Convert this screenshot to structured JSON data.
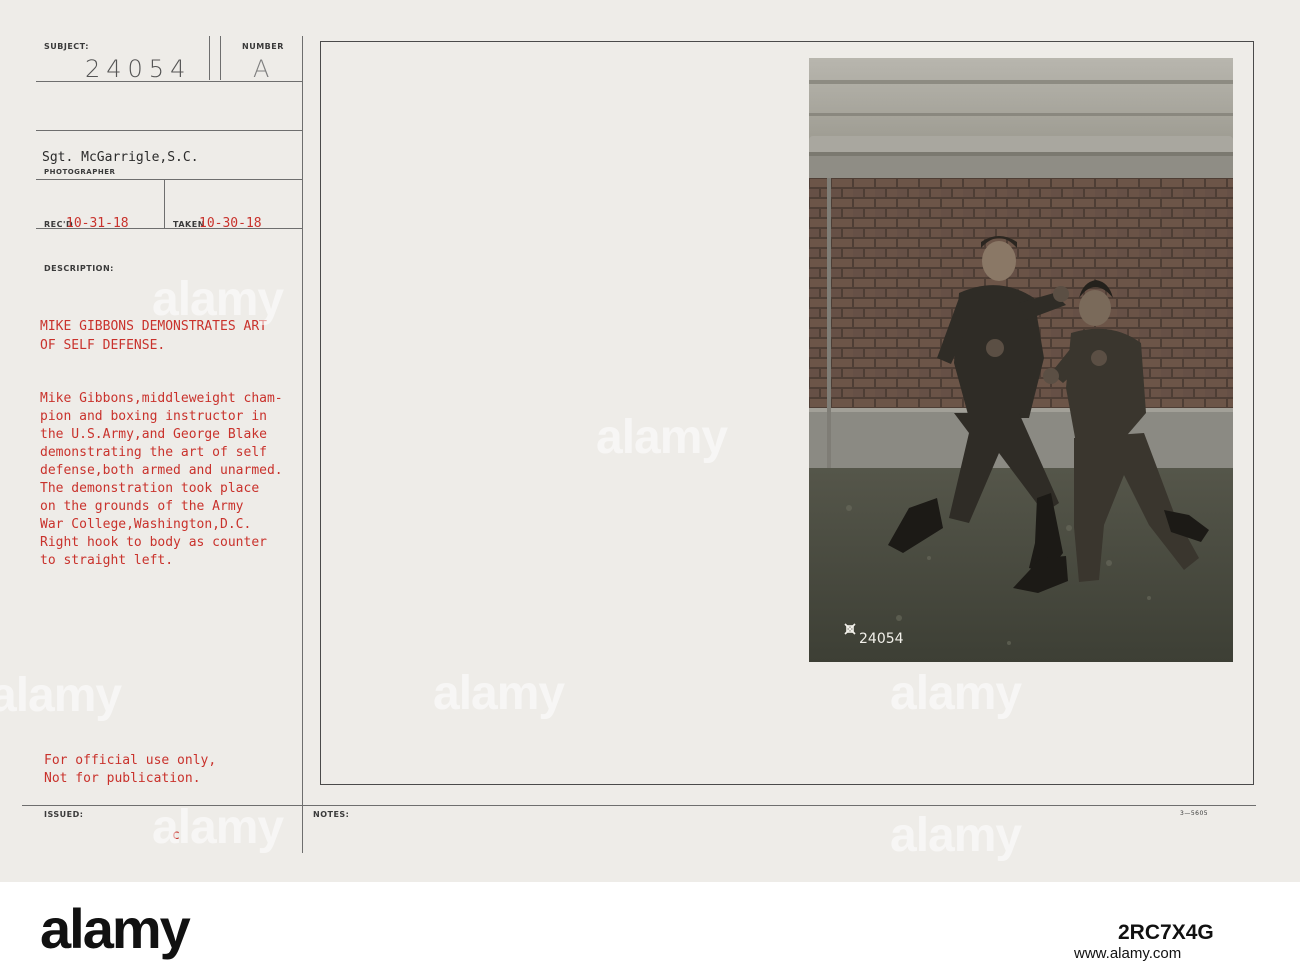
{
  "form": {
    "subject_label": "SUBJECT:",
    "subject_value": "24054",
    "number_label": "NUMBER",
    "number_value": "A",
    "photographer_value": "Sgt. McGarrigle,S.C.",
    "photographer_label": "PHOTOGRAPHER",
    "recd_label": "REC'D",
    "recd_value": "10-31-18",
    "taken_label": "TAKEN",
    "taken_value": "10-30-18",
    "description_label": "DESCRIPTION:",
    "title_lines": [
      "MIKE GIBBONS DEMONSTRATES ART",
      "OF SELF DEFENSE."
    ],
    "description_lines": [
      "Mike Gibbons,middleweight cham-",
      "pion and boxing instructor in",
      "the U.S.Army,and George Blake",
      "demonstrating the art of self",
      "defense,both armed and unarmed.",
      "The demonstration took place",
      "on the grounds of the Army",
      "War College,Washington,D.C.",
      "Right hook to body as counter",
      "to straight left."
    ],
    "official_lines": [
      "For official use only,",
      "Not for publication."
    ],
    "issued_label": "ISSUED:",
    "issued_value": "c",
    "notes_label": "NOTES:",
    "form_code": "3—5605"
  },
  "photo": {
    "negative_number": "24054"
  },
  "watermark": {
    "text": "alamy"
  },
  "footer": {
    "logo": "alamy",
    "image_id": "2RC7X4G",
    "url": "www.alamy.com"
  },
  "colors": {
    "card_bg": "#eeece8",
    "typed_red": "#c9322c",
    "typed_black": "#2b2b2b"
  }
}
